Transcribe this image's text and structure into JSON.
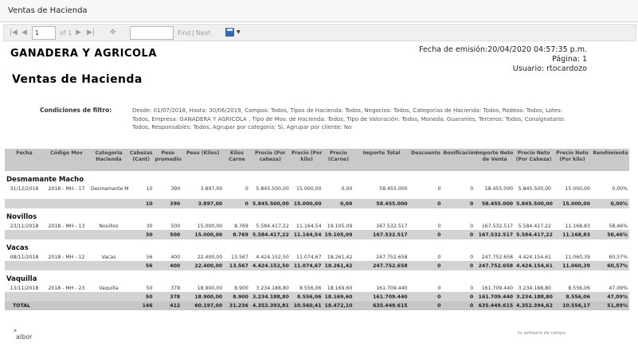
{
  "window": {
    "title": "Ventas de Hacienda"
  },
  "toolbar": {
    "page_value": "1",
    "page_of": "of 1",
    "find_value": "",
    "find_label": "Find",
    "separator": "|",
    "next_label": "Next",
    "icons": [
      "first-page-icon",
      "previous-page-icon",
      "next-page-icon",
      "last-page-icon",
      "back-icon",
      "save-icon",
      "dropdown-icon"
    ]
  },
  "header": {
    "company": "GANADERA Y AGRICOLA",
    "report_title": "Ventas de Hacienda",
    "emission": "Fecha de emisión:20/04/2020 04:57:35 p.m.",
    "page": "Página: 1",
    "user": "Usuario: rtocardozo"
  },
  "filter": {
    "label": "Condiciones de filtro:",
    "text": "Desde: 01/07/2018, Hasta: 30/06/2019, Campos: Todos, Tipos de Hacienda: Todos, Negocios: Todos, Categorias de Hacienda: Todos, Rodeos: Todos, Lotes: Todos, Empresa: GANADERA Y AGRICOLA , Tipo de Mov. de Hacienda: Todos, Tipo de Valoración: Todos, Moneda: Guaranies, Terceros: Todos, Consignatario: Todos, Responsables: Todos, Agrupar por categoría: Sí, Agrupar por cliente: No"
  },
  "table": {
    "columns": [
      "Fecha",
      "Código Mov",
      "Categoría Hacienda",
      "Cabezas (Cant)",
      "Peso promedio",
      "Peso (Kilos)",
      "Kilos Carne",
      "Precio (Por cabeza)",
      "Precio (Por kilo)",
      "Precio (Carne)",
      "Importe Total",
      "Descuento",
      "Bonificación",
      "Importe Neto de Venta",
      "Precio Neto (Por Cabeza)",
      "Precio Neto (Por kilo)",
      "Rendimiento"
    ],
    "groups": [
      {
        "name": "Desmamante Macho",
        "row": [
          "31/12/2018",
          "2018 - MH - 17",
          "Desmamante Macho",
          "10",
          "390",
          "3.897,00",
          "0",
          "5.845.500,00",
          "15.000,00",
          "0,00",
          "58.455.000",
          "0",
          "0",
          "58.455.000",
          "5.845.500,00",
          "15.000,00",
          "0,00%"
        ],
        "subtotal": [
          "",
          "",
          "",
          "10",
          "390",
          "3.897,00",
          "0",
          "5.845.500,00",
          "15.000,00",
          "0,00",
          "58.455.000",
          "0",
          "0",
          "58.455.000",
          "5.845.500,00",
          "15.000,00",
          "0,00%"
        ]
      },
      {
        "name": "Novillos",
        "row": [
          "23/11/2018",
          "2018 - MH - 13",
          "Novillos",
          "30",
          "500",
          "15.000,00",
          "8.769",
          "5.584.417,22",
          "11.164,54",
          "19.105,09",
          "167.532.517",
          "0",
          "0",
          "167.532.517",
          "5.584.417,22",
          "11.168,83",
          "58,46%"
        ],
        "subtotal": [
          "",
          "",
          "",
          "30",
          "500",
          "15.000,00",
          "8.769",
          "5.584.417,22",
          "11.164,54",
          "19.105,09",
          "167.532.517",
          "0",
          "0",
          "167.532.517",
          "5.584.417,22",
          "11.168,83",
          "58,46%"
        ]
      },
      {
        "name": "Vacas",
        "row": [
          "08/11/2018",
          "2018 - MH - 12",
          "Vacas",
          "56",
          "400",
          "22.400,00",
          "13.567",
          "4.424.152,50",
          "11.074,67",
          "18.261,42",
          "247.752.658",
          "0",
          "0",
          "247.752.658",
          "4.424.154,61",
          "11.060,39",
          "60,57%"
        ],
        "subtotal": [
          "",
          "",
          "",
          "56",
          "400",
          "22.400,00",
          "13.567",
          "4.424.152,50",
          "11.074,67",
          "18.261,42",
          "247.752.658",
          "0",
          "0",
          "247.752.658",
          "4.424.154,61",
          "11.060,39",
          "60,57%"
        ]
      },
      {
        "name": "Vaquilla",
        "row": [
          "13/11/2018",
          "2018 - MH - 23",
          "Vaquilla",
          "50",
          "378",
          "18.900,00",
          "8.900",
          "3.234.188,80",
          "8.556,06",
          "18.169,60",
          "161.709.440",
          "0",
          "0",
          "161.709.440",
          "3.234.188,80",
          "8.556,06",
          "47,09%"
        ],
        "subtotal": [
          "",
          "",
          "",
          "50",
          "378",
          "18.900,00",
          "8.900",
          "3.234.188,80",
          "8.556,06",
          "18.169,60",
          "161.709.440",
          "0",
          "0",
          "161.709.440",
          "3.234.188,80",
          "8.556,06",
          "47,09%"
        ]
      }
    ],
    "total": [
      "TOTAL",
      "",
      "",
      "146",
      "412",
      "60.197,00",
      "31.236",
      "4.352.393,81",
      "10.560,41",
      "18.472,10",
      "635.449.615",
      "0",
      "0",
      "635.449.615",
      "4.352.394,62",
      "10.556,17",
      "51,89%"
    ]
  },
  "footer": {
    "logo_text": "albor",
    "software_text": "tu software de campo"
  }
}
